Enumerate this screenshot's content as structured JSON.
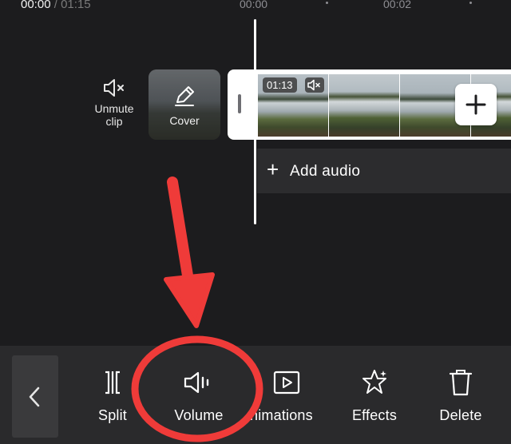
{
  "header": {
    "current_time": "00:00",
    "separator": "/",
    "total_time": "01:15",
    "ruler_ticks": [
      "00:00",
      "00:02"
    ]
  },
  "track": {
    "unmute_label": "Unmute\nclip",
    "unmute_line1": "Unmute",
    "unmute_line2": "clip",
    "cover_label": "Cover",
    "clip_duration": "01:13",
    "add_audio_label": "Add audio"
  },
  "toolbar": {
    "items": [
      {
        "label": "Split",
        "icon": "split-icon"
      },
      {
        "label": "Volume",
        "icon": "volume-icon"
      },
      {
        "label": "nimations",
        "icon": "animations-icon"
      },
      {
        "label": "Effects",
        "icon": "effects-icon"
      },
      {
        "label": "Delete",
        "icon": "delete-icon"
      }
    ]
  },
  "colors": {
    "background": "#1c1c1e",
    "toolbar": "#2a2a2c",
    "annotation_red": "#ef3b39",
    "playhead": "#ffffff"
  },
  "annotation": {
    "type": "red arrow pointing to circled Volume button"
  }
}
